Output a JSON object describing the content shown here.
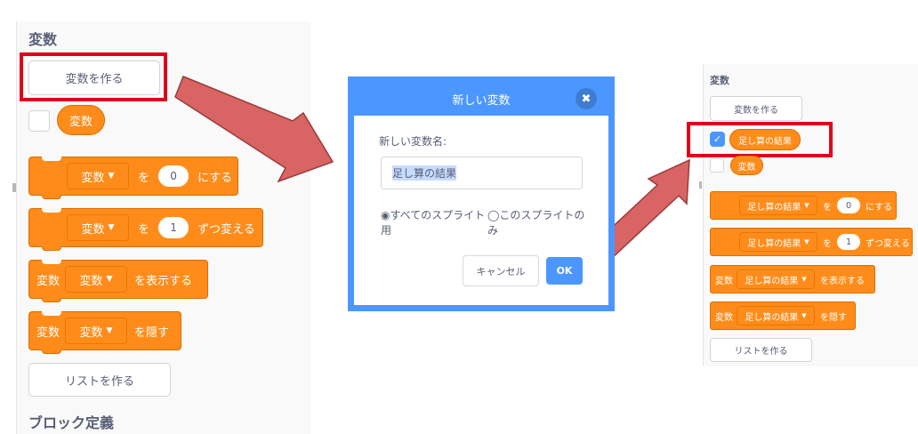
{
  "left_panel": {
    "section_title": "変数",
    "make_variable_button": "変数を作る",
    "variable_reporter": "変数",
    "set_block": {
      "dropdown": "変数",
      "word": "を",
      "value": "0",
      "suffix": "にする"
    },
    "change_block": {
      "dropdown": "変数",
      "word": "を",
      "value": "1",
      "suffix": "ずつ変える"
    },
    "show_block": {
      "prefix": "変数",
      "dropdown": "変数",
      "suffix": "を表示する"
    },
    "hide_block": {
      "prefix": "変数",
      "dropdown": "変数",
      "suffix": "を隠す"
    },
    "make_list_button": "リストを作る",
    "next_section_title": "ブロック定義"
  },
  "dialog": {
    "title": "新しい変数",
    "close_icon": "✖",
    "name_label": "新しい変数名:",
    "name_value": "足し算の結果",
    "radio_all": "◉すべてのスプライト用",
    "radio_this": "◯このスプライトのみ",
    "cancel_button": "キャンセル",
    "ok_button": "OK"
  },
  "right_panel": {
    "section_title": "変数",
    "make_variable_button": "変数を作る",
    "new_variable_reporter": "足し算の結果",
    "new_variable_checked": true,
    "variable_reporter": "変数",
    "set_block": {
      "dropdown": "足し算の結果",
      "word": "を",
      "value": "0",
      "suffix": "にする"
    },
    "change_block": {
      "dropdown": "足し算の結果",
      "word": "を",
      "value": "1",
      "suffix": "ずつ変える"
    },
    "show_block": {
      "prefix": "変数",
      "dropdown": "足し算の結果",
      "suffix": "を表示する"
    },
    "hide_block": {
      "prefix": "変数",
      "dropdown": "足し算の結果",
      "suffix": "を隠す"
    },
    "make_list_button": "リストを作る"
  },
  "icons": {
    "dropdown": "▼",
    "check": "✓",
    "arrow": "arrow-icon"
  },
  "colors": {
    "block_orange": "#ff8c1a",
    "accent_blue": "#4c97ff",
    "highlight_red": "#e0001b",
    "arrow_fill": "#d86464",
    "text_gray": "#575e75"
  }
}
